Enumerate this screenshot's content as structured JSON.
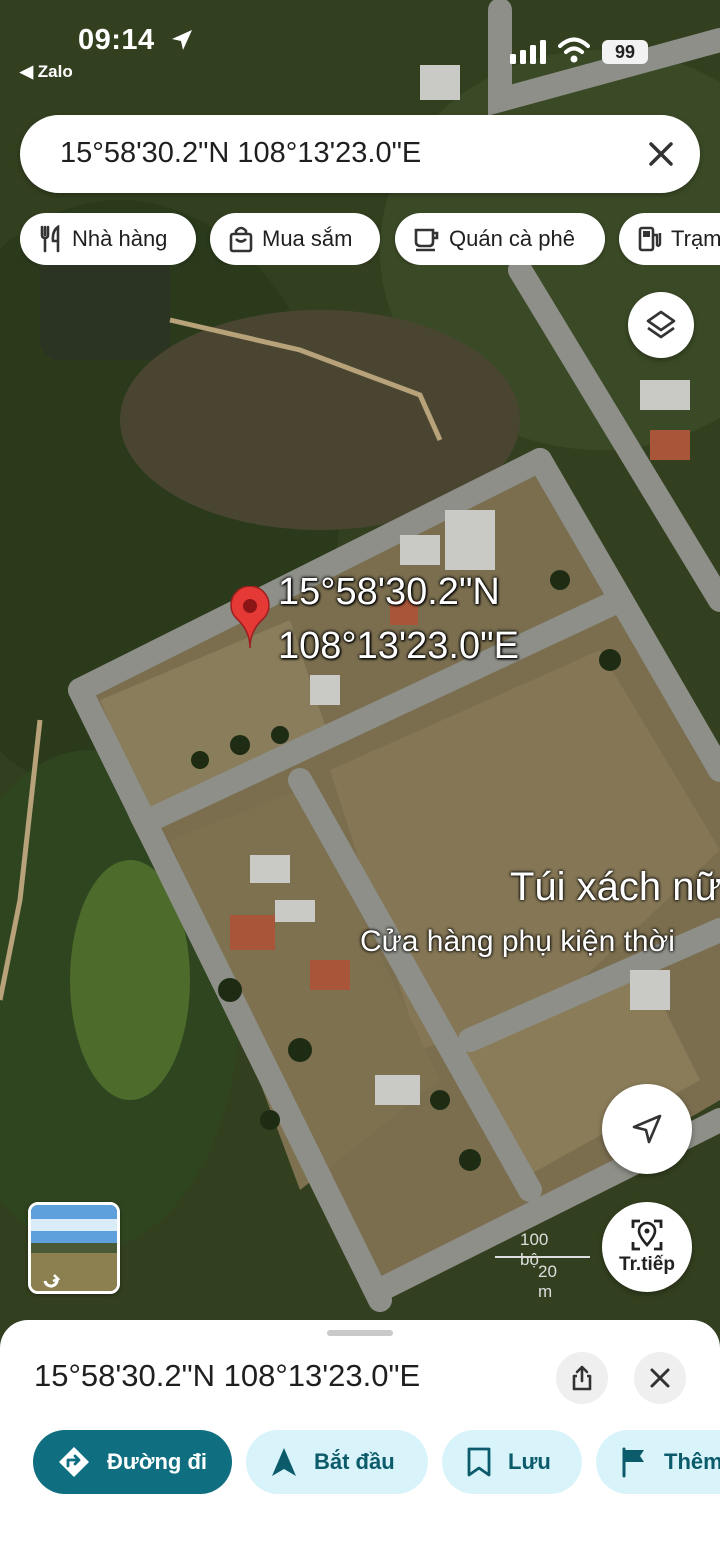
{
  "status_bar": {
    "time": "09:14",
    "back_app": "◀ Zalo",
    "battery": "99"
  },
  "search": {
    "value": "15°58'30.2\"N 108°13'23.0\"E"
  },
  "chips": [
    {
      "label": "Nhà hàng",
      "icon": "fork-knife-icon"
    },
    {
      "label": "Mua sắm",
      "icon": "shopping-bag-icon"
    },
    {
      "label": "Quán cà phê",
      "icon": "coffee-cup-icon"
    },
    {
      "label": "Trạm",
      "icon": "gas-station-icon"
    }
  ],
  "map": {
    "pin_label_line1": "15°58'30.2\"N",
    "pin_label_line2": "108°13'23.0\"E",
    "place_title": "Túi xách nữ",
    "place_subtitle": "Cửa hàng phụ kiện thời",
    "scale_feet": "100 bộ",
    "scale_meters": "20 m",
    "live_view_label": "Tr.tiếp"
  },
  "sheet": {
    "title": "15°58'30.2\"N 108°13'23.0\"E",
    "actions": [
      {
        "label": "Đường đi",
        "icon": "directions-icon"
      },
      {
        "label": "Bắt đầu",
        "icon": "navigation-arrow-icon"
      },
      {
        "label": "Lưu",
        "icon": "bookmark-icon"
      },
      {
        "label": "Thêm",
        "icon": "flag-icon"
      }
    ]
  },
  "colors": {
    "primary_action": "#0f6e80",
    "action_bg": "#d9f3fa",
    "pin": "#e53935"
  }
}
